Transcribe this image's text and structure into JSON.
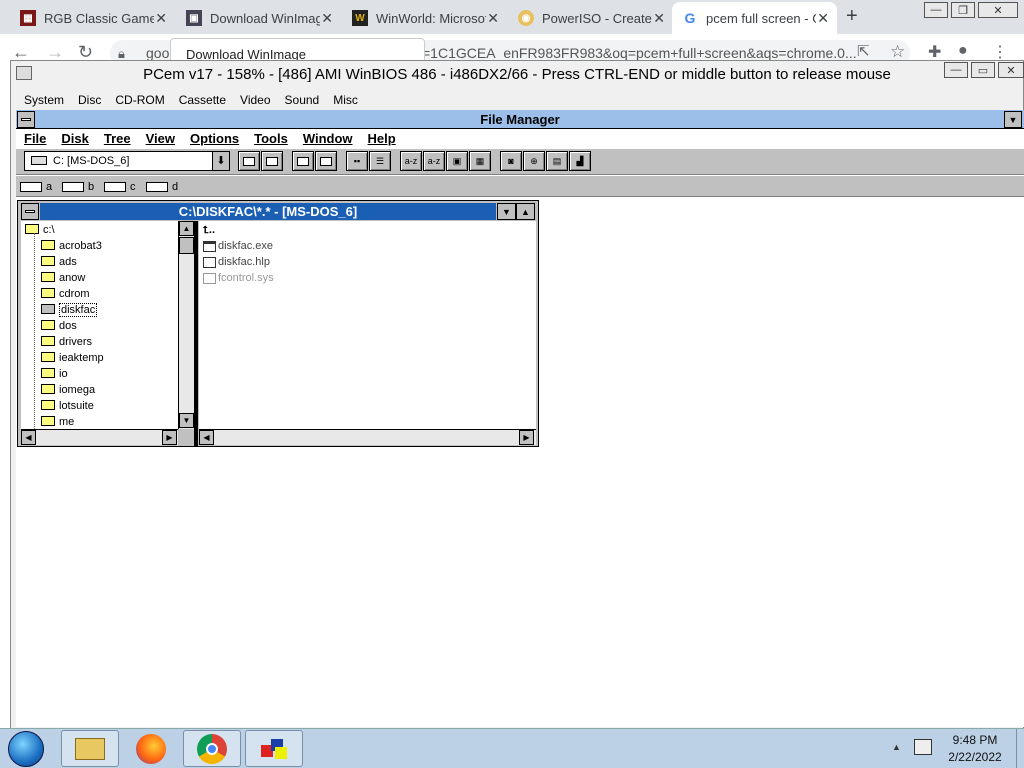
{
  "chrome": {
    "tabs": [
      {
        "title": "RGB Classic Games",
        "icon": "rgb-favicon"
      },
      {
        "title": "Download WinImage",
        "icon": "floppy-favicon"
      },
      {
        "title": "WinWorld: Microsoft",
        "icon": "winworld-favicon"
      },
      {
        "title": "PowerISO - Create,",
        "icon": "poweriso-favicon"
      },
      {
        "title": "pcem full screen - G",
        "icon": "google-favicon"
      }
    ],
    "close_glyph": "✕",
    "new_tab": "+",
    "omnibox_left": "goo",
    "omnibox_right": "=1C1GCEA_enFR983FR983&oq=pcem+full+screen&aqs=chrome.0...",
    "tooltip": "Download WinImage",
    "win_min": "—",
    "win_max": "❐",
    "win_close": "✕"
  },
  "pcem": {
    "title": "PCem v17 - 158% - [486] AMI WinBIOS 486 - i486DX2/66 - Press CTRL-END or middle button to release mouse",
    "menu": [
      "System",
      "Disc",
      "CD-ROM",
      "Cassette",
      "Video",
      "Sound",
      "Misc"
    ]
  },
  "filemanager": {
    "title": "File Manager",
    "menu": [
      "File",
      "Disk",
      "Tree",
      "View",
      "Options",
      "Tools",
      "Window",
      "Help"
    ],
    "drive_select": "C: [MS-DOS_6]",
    "drives": [
      "a",
      "b",
      "c",
      "d"
    ],
    "child_title": "C:\\DISKFAC\\*.* - [MS-DOS_6]",
    "tree": {
      "root": "c:\\",
      "folders": [
        "acrobat3",
        "ads",
        "anow",
        "cdrom",
        "diskfac",
        "dos",
        "drivers",
        "ieaktemp",
        "io",
        "iomega",
        "lotsuite",
        "me"
      ],
      "selected": "diskfac"
    },
    "files": [
      "..",
      "diskfac.exe",
      "diskfac.hlp",
      "fcontrol.sys"
    ]
  },
  "taskbar": {
    "time": "9:48 PM",
    "date": "2/22/2022"
  }
}
